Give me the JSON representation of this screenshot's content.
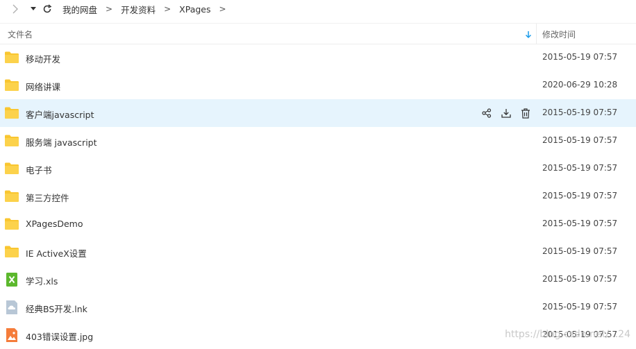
{
  "toolbar": {
    "back_icon": "chevron-right-icon",
    "dropdown_icon": "caret-down-icon",
    "refresh_icon": "refresh-icon"
  },
  "breadcrumb": {
    "items": [
      "我的网盘",
      "开发资料",
      "XPages"
    ],
    "separator": ">"
  },
  "header": {
    "name_label": "文件名",
    "time_label": "修改时间",
    "sort_icon": "sort-arrow-down-icon"
  },
  "files": [
    {
      "name": "移动开发",
      "time": "2015-05-19 07:57",
      "type": "folder"
    },
    {
      "name": "网络讲课",
      "time": "2020-06-29 10:28",
      "type": "folder"
    },
    {
      "name": "客户端javascript",
      "time": "2015-05-19 07:57",
      "type": "folder",
      "hovered": true
    },
    {
      "name": "服务端 javascript",
      "time": "2015-05-19 07:57",
      "type": "folder"
    },
    {
      "name": "电子书",
      "time": "2015-05-19 07:57",
      "type": "folder"
    },
    {
      "name": "第三方控件",
      "time": "2015-05-19 07:57",
      "type": "folder"
    },
    {
      "name": "XPagesDemo",
      "time": "2015-05-19 07:57",
      "type": "folder"
    },
    {
      "name": "IE ActiveX设置",
      "time": "2015-05-19 07:57",
      "type": "folder"
    },
    {
      "name": "学习.xls",
      "time": "2015-05-19 07:57",
      "type": "excel"
    },
    {
      "name": "经典BS开发.lnk",
      "time": "2015-05-19 07:57",
      "type": "link"
    },
    {
      "name": "403错误设置.jpg",
      "time": "2015-05-19 07:57",
      "type": "image"
    }
  ],
  "row_actions": [
    "share-icon",
    "download-icon",
    "delete-icon"
  ],
  "colors": {
    "folder": "#F9C630",
    "hover_row": "#E6F4FD",
    "accent": "#1A9BEA",
    "excel": "#5CB82D",
    "link": "#B8C7D6",
    "image": "#F57C3A"
  },
  "watermark": "https://blog.csdn.net/...24"
}
